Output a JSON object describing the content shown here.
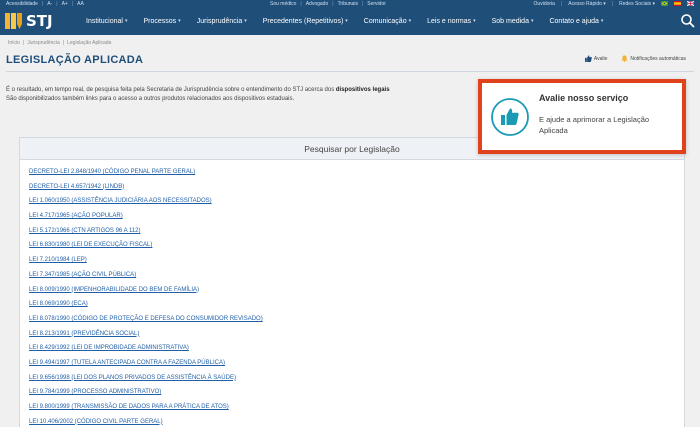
{
  "topbar": {
    "left": [
      "Acessibilidade",
      "A-",
      "A+",
      "AA"
    ],
    "mid": [
      "Sou médico",
      "Advogado",
      "Tribunais",
      "Servidor"
    ],
    "right": [
      "Ouvidoria",
      "Acesso Rápido",
      "Redes Sociais"
    ]
  },
  "brand": {
    "name": "STJ"
  },
  "nav": {
    "items": [
      "Institucional",
      "Processos",
      "Jurisprudência",
      "Precedentes (Repetitivos)",
      "Comunicação",
      "Leis e normas",
      "Sob medida",
      "Contato e ajuda"
    ]
  },
  "breadcrumb": [
    "Início",
    "Jurisprudência",
    "Legislação Aplicada"
  ],
  "page": {
    "title": "LEGISLAÇÃO APLICADA",
    "action_rate": "Avalie",
    "action_notify": "Notificações automáticas",
    "intro_1": "É o resultado, em tempo real, de pesquisa feita pela Secretaria de Jurisprudência sobre o entendimento do STJ acerca dos ",
    "intro_bold": "dispositivos legais",
    "intro_2": "São disponibilizados também links para o acesso a outros produtos relacionados aos dispositivos estaduais."
  },
  "search": {
    "header": "Pesquisar por Legislação",
    "laws": [
      "DECRETO-LEI 2.848/1940 (CÓDIGO PENAL PARTE GERAL)",
      "DECRETO-LEI 4.657/1942 (LINDB)",
      "LEI 1.060/1950 (ASSISTÊNCIA JUDICIÁRIA AOS NECESSITADOS)",
      "LEI 4.717/1965 (AÇÃO POPULAR)",
      "LEI 5.172/1966 (CTN ARTIGOS 96 A 112)",
      "LEI 6.830/1980 (LEI DE EXECUÇÃO FISCAL)",
      "LEI 7.210/1984 (LEP)",
      "LEI 7.347/1985 (AÇÃO CIVIL PÚBLICA)",
      "LEI 8.009/1990 (IMPENHORABILIDADE DO BEM DE FAMÍLIA)",
      "LEI 8.069/1990 (ECA)",
      "LEI 8.078/1990 (CÓDIGO DE PROTEÇÃO E DEFESA DO CONSUMIDOR REVISADO)",
      "LEI 8.213/1991 (PREVIDÊNCIA SOCIAL)",
      "LEI 8.429/1992 (LEI DE IMPROBIDADE ADMINISTRATIVA)",
      "LEI 9.494/1997 (TUTELA ANTECIPADA CONTRA A FAZENDA PÚBLICA)",
      "LEI 9.656/1998 (LEI DOS PLANOS PRIVADOS DE ASSISTÊNCIA À SAÚDE)",
      "LEI 9.784/1999 (PROCESSO ADMINISTRATIVO)",
      "LEI 9.800/1999 (TRANSMISSÃO DE DADOS PARA A PRÁTICA DE ATOS)",
      "LEI 10.406/2002 (CÓDIGO CIVIL PARTE GERAL)"
    ]
  },
  "popup": {
    "title": "Avalie nosso serviço",
    "subtitle": "E ajude a aprimorar a Legislação Aplicada"
  },
  "colors": {
    "brand": "#1f4e79",
    "link": "#1f5fa8",
    "popup_border": "#e0421c",
    "popup_icon": "#1a9bb5"
  }
}
